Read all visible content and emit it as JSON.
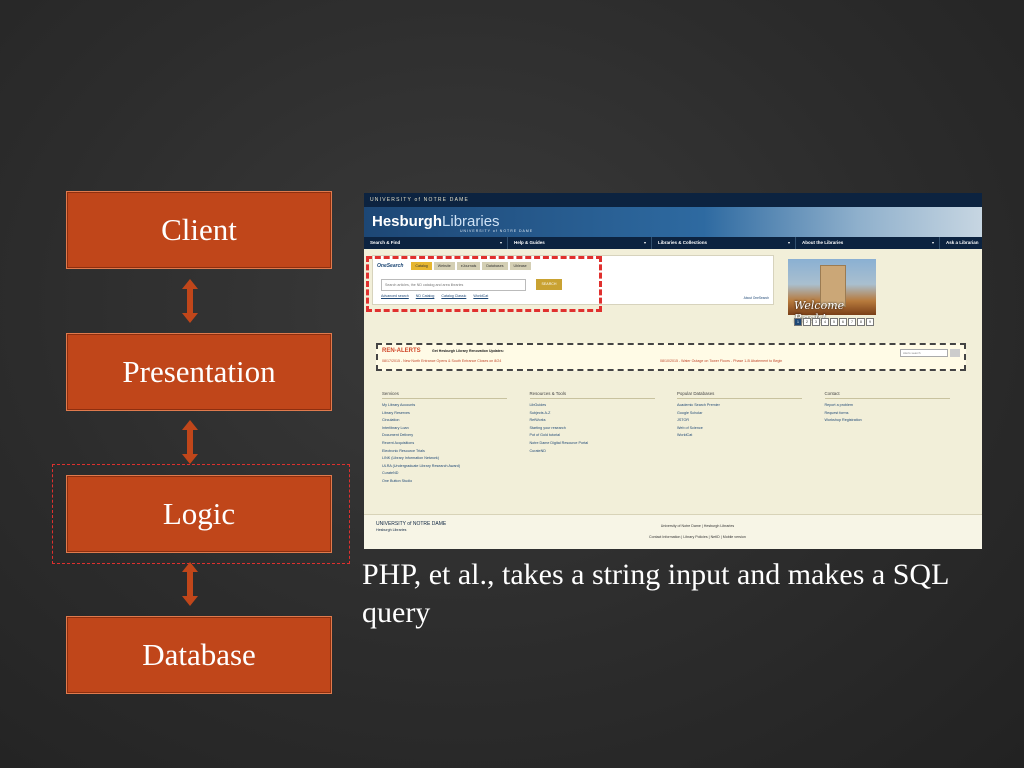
{
  "tiers": {
    "client": "Client",
    "presentation": "Presentation",
    "logic": "Logic",
    "database": "Database"
  },
  "caption": "PHP, et al., takes a string input and makes a SQL query",
  "screenshot": {
    "university_bar": "UNIVERSITY of NOTRE DAME",
    "brand_bold": "Hesburgh",
    "brand_light": "Libraries",
    "brand_sub": "UNIVERSITY of NOTRE DAME",
    "nav": [
      "Search & Find",
      "Help & Guides",
      "Libraries & Collections",
      "About the Libraries",
      "Ask a Librarian"
    ],
    "search": {
      "logo": "OneSearch",
      "tabs": [
        "Catalog",
        "Website",
        "eJournals",
        "Databases",
        "Ublease"
      ],
      "placeholder": "Search articles, the ND catalog and area libraries",
      "button": "SEARCH",
      "links": [
        "Advanced search",
        "ND Catalog",
        "Catalog Classic",
        "WorldCat"
      ],
      "about": "About OneSearch"
    },
    "welcome": "Welcome Back!",
    "pager": [
      "1",
      "2",
      "3",
      "4",
      "5",
      "6",
      "7",
      "8",
      "9"
    ],
    "alerts": {
      "title": "REN-ALERTS",
      "sub": "Get Hesburgh Library Renovation Updates:",
      "item_a": "08/17/2015 - New North Entrance Opens & South Entrance Closes on 8/24",
      "item_b": "08/10/2015 - Water Outage on Tower Floors - Phase 1-B Abatement to Begin",
      "search_placeholder": "Alerts search"
    },
    "columns": [
      {
        "heading": "Services",
        "items": [
          "My Library Accounts",
          "Library Reserves",
          "Circulation",
          "Interlibrary Loan",
          "Document Delivery",
          "Recent Acquisitions",
          "Electronic Resource Trials",
          "LINK (Library Information Network)",
          "ULRA (Undergraduate Library Research Award)",
          "CurateND",
          "One Button Studio"
        ]
      },
      {
        "heading": "Resources & Tools",
        "items": [
          "LibGuides",
          "Subjects A-Z",
          "RefWorks",
          "Starting your research",
          "Pot of Gold tutorial",
          "Notre Dame Digital Resource Portal",
          "CurateND"
        ]
      },
      {
        "heading": "Popular Databases",
        "items": [
          "Academic Search Premier",
          "Google Scholar",
          "JSTOR",
          "Web of Science",
          "WorldCat"
        ]
      },
      {
        "heading": "Contact",
        "items": [
          "Report a problem",
          "Request forms",
          "Workshop Registration"
        ]
      }
    ],
    "footer": {
      "logo_top": "UNIVERSITY of NOTRE DAME",
      "logo_sub": "Hesburgh Libraries",
      "line1": "University of Notre Dame | Hesburgh Libraries",
      "line2": "Contact Information | Library Policies | NetID | Mobile version"
    }
  }
}
